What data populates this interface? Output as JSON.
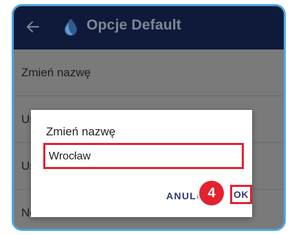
{
  "appbar": {
    "title": "Opcje Default",
    "back_icon": "arrow-left-icon",
    "logo_icon": "water-drop-icon"
  },
  "list": {
    "items": [
      {
        "label": "Zmień nazwę"
      },
      {
        "label": "Usuń"
      },
      {
        "label": "Ustawienia"
      },
      {
        "label": "Nowa"
      }
    ]
  },
  "dialog": {
    "title": "Zmień nazwę",
    "input_value": "Wrocław",
    "cancel_label": "ANULUJ",
    "ok_label": "OK",
    "step_badge": "4"
  },
  "colors": {
    "appbar": "#0f1a3a",
    "highlight": "#e4212f",
    "frame_border": "#4da6dc",
    "overlay": "#7a7a7a",
    "button_text": "#2c3a6e"
  }
}
